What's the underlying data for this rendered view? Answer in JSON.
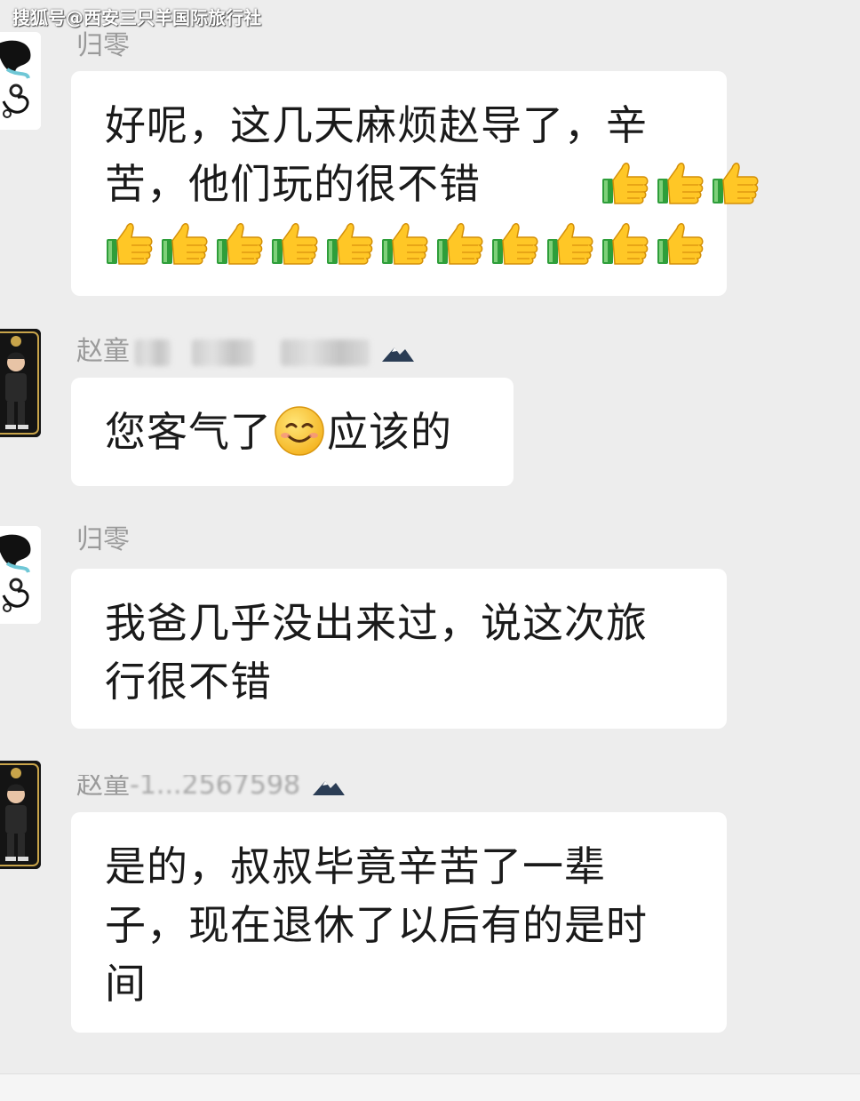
{
  "watermark": "搜狐号@西安三只羊国际旅行社",
  "messages": [
    {
      "sender": "归零",
      "text": "好呢，这几天麻烦赵导了，辛\n苦，他们玩的很不错",
      "trailing_icon": "thumbs-up-icon",
      "trailing_count": 3,
      "extra_row_icon": "thumbs-up-icon",
      "extra_row_count": 11
    },
    {
      "sender": "赵童",
      "text_before": "您客气了",
      "inline_icon": "smiling-face-icon",
      "text_after": "应该的"
    },
    {
      "sender": "归零",
      "text": "我爸几乎没出来过，说这次旅\n行很不错"
    },
    {
      "sender": "赵童",
      "sender_partial_number": "-1...2567598",
      "text": "是的，叔叔毕竟辛苦了一辈\n子，现在退休了以后有的是时\n间"
    }
  ],
  "colors": {
    "background": "#ededed",
    "bubble": "#ffffff",
    "text": "#1a1a1a",
    "sender": "#9a9a9a"
  }
}
